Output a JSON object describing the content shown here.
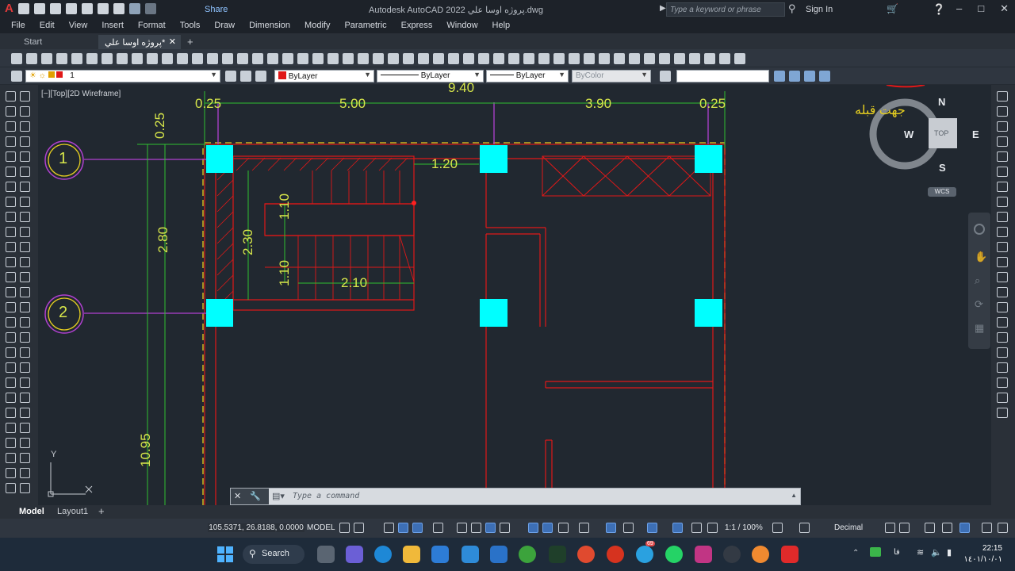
{
  "titlebar": {
    "share_label": "Share",
    "title": "Autodesk AutoCAD 2022   پروژه اوسا علي.dwg",
    "search_placeholder": "Type a keyword or phrase",
    "signin_label": "Sign In"
  },
  "menu": [
    "File",
    "Edit",
    "View",
    "Insert",
    "Format",
    "Tools",
    "Draw",
    "Dimension",
    "Modify",
    "Parametric",
    "Express",
    "Window",
    "Help"
  ],
  "tabs": {
    "start": "Start",
    "drawing": "پروژه اوسا علي*"
  },
  "properties": {
    "layer": "1",
    "color": "ByLayer",
    "linetype": "ByLayer",
    "lineweight": "ByLayer",
    "plotstyle": "ByColor"
  },
  "viewport_label": "[−][Top][2D Wireframe]",
  "viewcube": {
    "north": "N",
    "south": "S",
    "east": "E",
    "west": "W",
    "face": "TOP",
    "wcs": "WCS"
  },
  "drawing": {
    "qibla_label": "جهت قبله",
    "dims_top": [
      "9.40",
      "0.25",
      "5.00",
      "3.90",
      "0.25"
    ],
    "dims_left": [
      "0.25",
      "2.80",
      "10.95"
    ],
    "dims_inner": [
      "1.20",
      "1.10",
      "2.30",
      "1.10",
      "2.10"
    ],
    "grid_labels": [
      "1",
      "2"
    ],
    "ucs_y": "Y"
  },
  "command_placeholder": "Type a command",
  "layout_tabs": {
    "model": "Model",
    "layout1": "Layout1",
    "add": "+"
  },
  "status": {
    "coordinates": "105.5371, 26.8188, 0.0000",
    "model": "MODEL",
    "scale": "1:1 / 100%",
    "units": "Decimal"
  },
  "taskbar": {
    "search_label": "Search",
    "time": "22:15",
    "date": "١٤٠١/١٠/٠١",
    "lang": "فا",
    "badge": "69"
  },
  "colors": {
    "dimension": "#d7e64a",
    "column": "#00ffff",
    "wall": "#e01818",
    "grid_line": "#b040d0",
    "yellow_dash": "#e8d020",
    "green_dim": "#30c030"
  }
}
